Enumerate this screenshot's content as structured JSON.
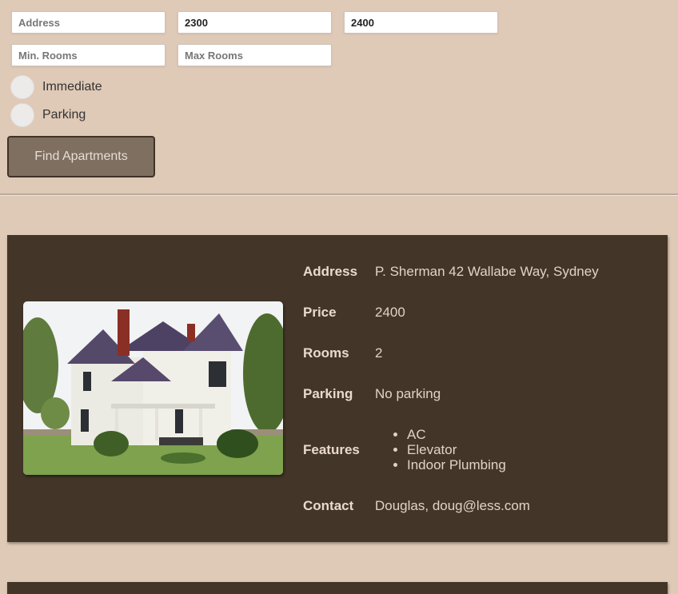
{
  "search": {
    "address_placeholder": "Address",
    "min_price_value": "2300",
    "max_price_value": "2400",
    "min_rooms_placeholder": "Min. Rooms",
    "max_rooms_placeholder": "Max Rooms",
    "immediate_label": "Immediate",
    "parking_label": "Parking",
    "find_button_label": "Find Apartments"
  },
  "listing": {
    "labels": {
      "address": "Address",
      "price": "Price",
      "rooms": "Rooms",
      "parking": "Parking",
      "features": "Features",
      "contact": "Contact"
    },
    "address": "P. Sherman 42 Wallabe Way, Sydney",
    "price": "2400",
    "rooms": "2",
    "parking": "No parking",
    "features": [
      "AC",
      "Elevator",
      "Indoor Plumbing"
    ],
    "contact": "Douglas, doug@less.com"
  },
  "colors": {
    "page_background": "#dfc9b7",
    "card_background": "#433628",
    "button_background": "#7e6f60"
  }
}
